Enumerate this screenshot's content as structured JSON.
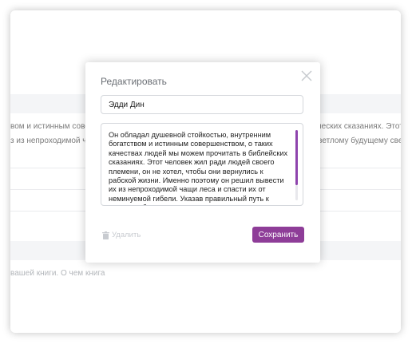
{
  "background": {
    "row1_text_left": "вом и истинным совер",
    "row2_text_left": "з из непроходимой чащ",
    "row1_text_right": "лических сказаниях. Этот чел",
    "row2_text_right": "к светлому будущему све",
    "footer_text": "вашей книги. О чем книга"
  },
  "modal": {
    "title": "Редактировать",
    "name_value": "Эдди Дин",
    "description": "Он обладал душевной стойкостью, внутренним богатством и истинным совершенством, о таких качествах людей мы можем прочитать в библейских сказаниях. Этот человек жил ради людей своего племени, он не хотел, чтобы они вернулись к рабской жизни. Именно поэтому он решил вывести их из непроходимой чащи леса и спасти их от неминуемой гибели. Указав правильный путь к светлому будущему светом своего сердца, он",
    "delete_label": "Удалить",
    "save_label": "Сохранить"
  },
  "icons": {
    "close": "close-icon",
    "trash": "trash-icon"
  },
  "colors": {
    "accent": "#8e3d98",
    "scrollbar": "#8e44ad",
    "disabled": "#c8cbd0"
  }
}
